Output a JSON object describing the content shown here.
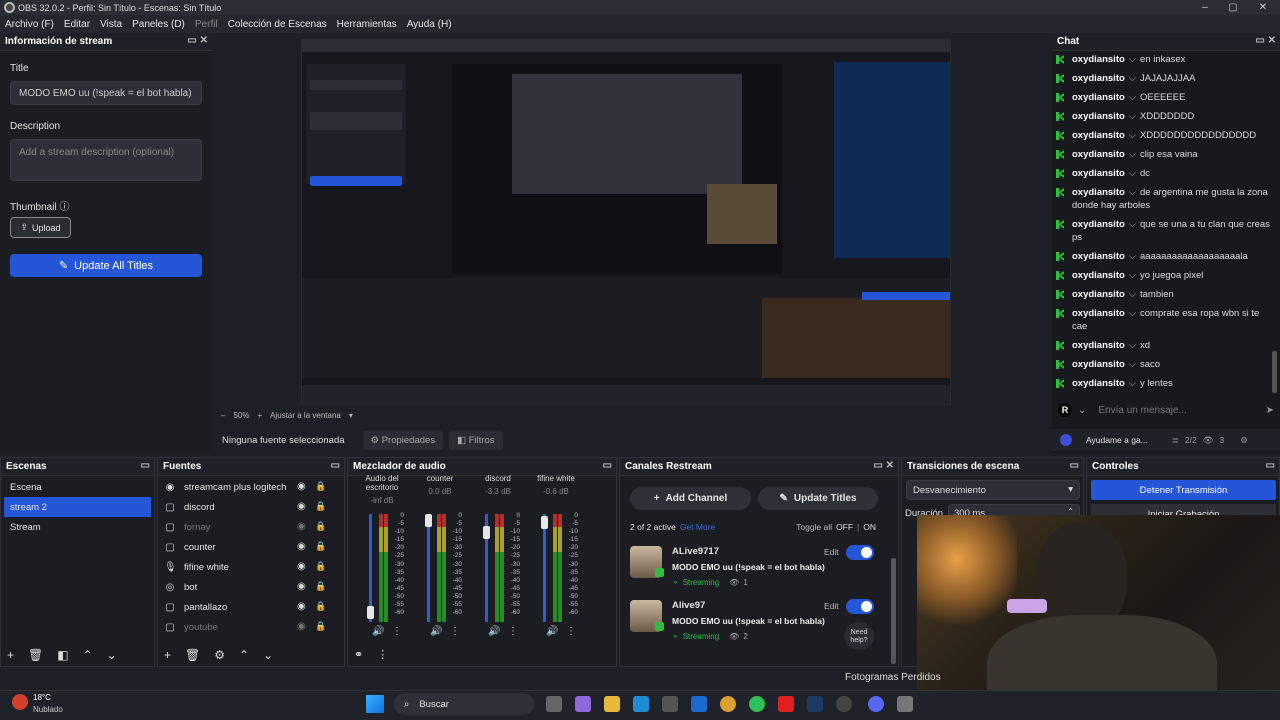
{
  "window": {
    "title": "OBS 32.0.2 - Perfil: Sin Título - Escenas: Sin Título",
    "minimize": "–",
    "maximize": "▢",
    "close": "✕"
  },
  "menu": [
    "Archivo (F)",
    "Editar",
    "Vista",
    "Paneles (D)",
    "Perfil",
    "Colección de Escenas",
    "Herramientas",
    "Ayuda (H)"
  ],
  "stream_info": {
    "panel_title": "Información de stream",
    "title_label": "Title",
    "title_value": "MODO EMO uu (!speak = el bot habla)",
    "description_label": "Description",
    "description_placeholder": "Add a stream description (optional)",
    "thumbnail_label": "Thumbnail",
    "upload_label": "Upload",
    "update_label": "Update All Titles"
  },
  "preview": {
    "zoom_minus": "–",
    "zoom_value": "50%",
    "zoom_plus": "+",
    "fit_label": "Ajustar a la ventana"
  },
  "source_bar": {
    "no_source": "Ninguna fuente seleccionada",
    "properties": "Propiedades",
    "filters": "Filtros"
  },
  "chat": {
    "panel_title": "Chat",
    "placeholder": "Envía un mensaje...",
    "footer_label": "Ayudame a ga...",
    "count_a": "2/2",
    "count_b": "3",
    "messages": [
      {
        "user": "oxydiansito",
        "msg": "en inkasex"
      },
      {
        "user": "oxydiansito",
        "msg": "JAJAJAJJAA"
      },
      {
        "user": "oxydiansito",
        "msg": "OEEEEEE"
      },
      {
        "user": "oxydiansito",
        "msg": "XDDDDDDD"
      },
      {
        "user": "oxydiansito",
        "msg": "XDDDDDDDDDDDDDDDD"
      },
      {
        "user": "oxydiansito",
        "msg": "clip esa vaina"
      },
      {
        "user": "oxydiansito",
        "msg": "dc"
      },
      {
        "user": "oxydiansito",
        "msg": "de argentina me gusta la zona donde hay arboles"
      },
      {
        "user": "oxydiansito",
        "msg": "que se una a tu clan que creas ps"
      },
      {
        "user": "oxydiansito",
        "msg": "aaaaaaaaaaaaaaaaaaala"
      },
      {
        "user": "oxydiansito",
        "msg": "yo juegoa pixel"
      },
      {
        "user": "oxydiansito",
        "msg": "tambien"
      },
      {
        "user": "oxydiansito",
        "msg": "comprate esa ropa wbn si te cae"
      },
      {
        "user": "oxydiansito",
        "msg": "xd"
      },
      {
        "user": "oxydiansito",
        "msg": "saco"
      },
      {
        "user": "oxydiansito",
        "msg": "y lentes"
      }
    ]
  },
  "scenes": {
    "panel_title": "Escenas",
    "items": [
      "Escena",
      "stream 2",
      "Stream"
    ],
    "selected": "stream 2"
  },
  "sources": {
    "panel_title": "Fuentes",
    "items": [
      {
        "name": "streamcam plus logitech",
        "icon": "camera-icon",
        "dim": false
      },
      {
        "name": "discord",
        "icon": "window-icon",
        "dim": false
      },
      {
        "name": "fornay",
        "icon": "window-icon",
        "dim": true
      },
      {
        "name": "counter",
        "icon": "window-icon",
        "dim": false
      },
      {
        "name": "fifine white",
        "icon": "mic-icon",
        "dim": false
      },
      {
        "name": "bot",
        "icon": "browser-icon",
        "dim": false
      },
      {
        "name": "pantallazo",
        "icon": "window-icon",
        "dim": false
      },
      {
        "name": "youtube",
        "icon": "window-icon",
        "dim": true
      }
    ]
  },
  "mixer": {
    "panel_title": "Mezclador de audio",
    "scale": [
      "0",
      "-5",
      "-10",
      "-15",
      "-20",
      "-25",
      "-30",
      "-35",
      "-40",
      "-45",
      "-50",
      "-55",
      "-60"
    ],
    "channels": [
      {
        "name": "Audio del escritorio",
        "db": "-inf dB",
        "level": 0.08
      },
      {
        "name": "counter",
        "db": "0.0 dB",
        "level": 1.0
      },
      {
        "name": "discord",
        "db": "-3.3 dB",
        "level": 0.88
      },
      {
        "name": "fifine white",
        "db": "-0.6 dB",
        "level": 0.98
      }
    ]
  },
  "restream": {
    "panel_title": "Canales Restream",
    "add_label": "Add Channel",
    "update_label": "Update Titles",
    "active_text": "2 of 2 active",
    "get_more": "Get More",
    "toggle_all": "Toggle all",
    "off": "OFF",
    "on": "ON",
    "channels": [
      {
        "name": "ALive9717",
        "edit": "Edit",
        "title": "MODO EMO uu (!speak = el bot habla)",
        "status": "Streaming",
        "viewers": "1"
      },
      {
        "name": "Alive97",
        "edit": "Edit",
        "title": "MODO EMO uu (!speak = el bot habla)",
        "status": "Streaming",
        "viewers": "2"
      }
    ],
    "need_help": "Need help?"
  },
  "transitions": {
    "panel_title": "Transiciones de escena",
    "value": "Desvanecimiento",
    "duration_label": "Duración",
    "duration_value": "300 ms"
  },
  "controls": {
    "panel_title": "Controles",
    "stop_stream": "Detener Transmisión",
    "start_rec": "Iniciar Grabación"
  },
  "status": {
    "dropped": "Fotogramas Perdidos"
  },
  "taskbar": {
    "temp": "18°C",
    "weather": "Nublado",
    "search": "Buscar"
  },
  "colors": {
    "accent": "#2556d8",
    "selected": "#2556d8",
    "streaming": "#2fbf3f",
    "chat_badge": "#2fbf3f"
  }
}
